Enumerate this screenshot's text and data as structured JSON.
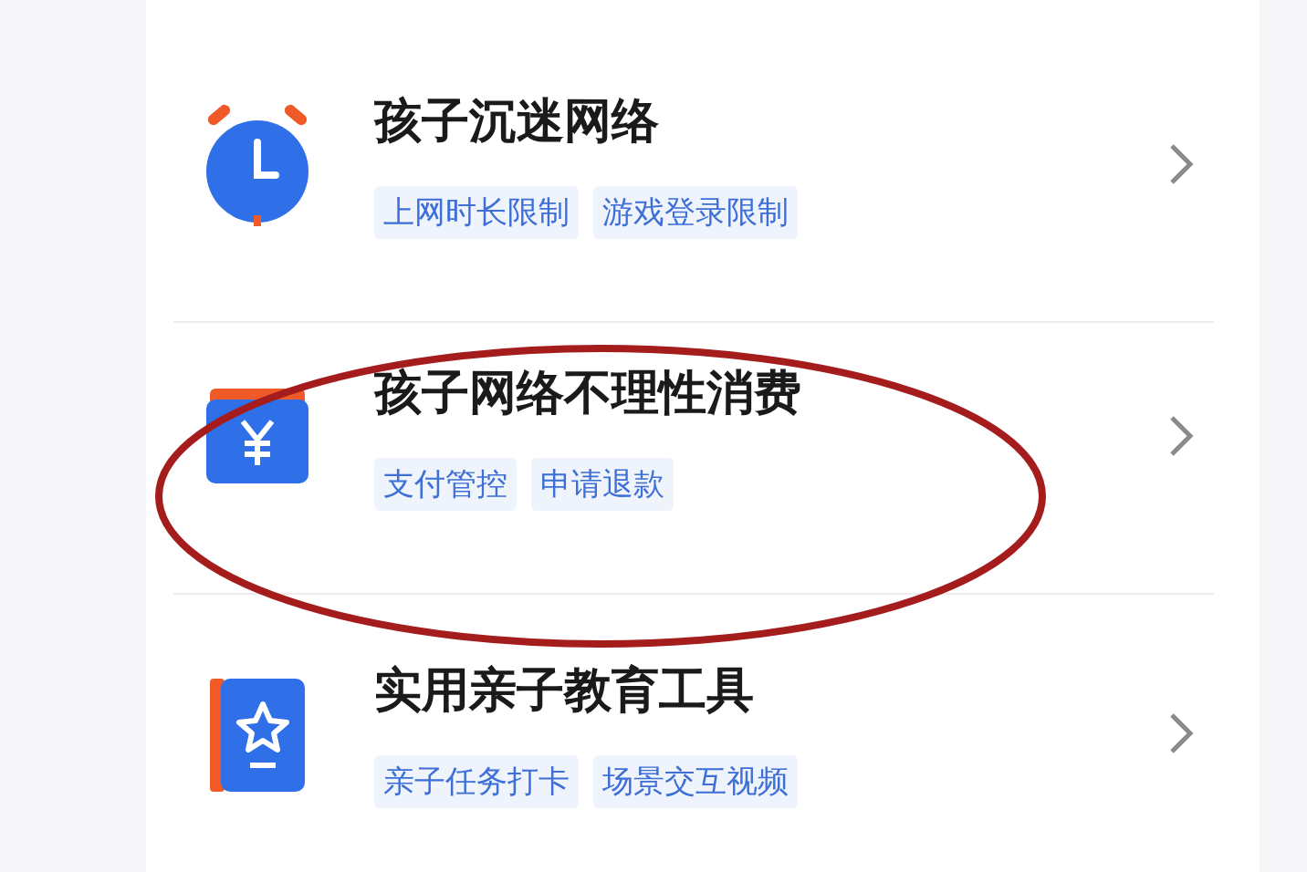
{
  "items": [
    {
      "title": "孩子沉迷网络",
      "tags": [
        "上网时长限制",
        "游戏登录限制"
      ],
      "kind": "clock",
      "circled": false
    },
    {
      "title": "孩子网络不理性消费",
      "tags": [
        "支付管控",
        "申请退款"
      ],
      "kind": "wallet",
      "circled": true
    },
    {
      "title": "实用亲子教育工具",
      "tags": [
        "亲子任务打卡",
        "场景交互视频"
      ],
      "kind": "book",
      "circled": false
    }
  ]
}
